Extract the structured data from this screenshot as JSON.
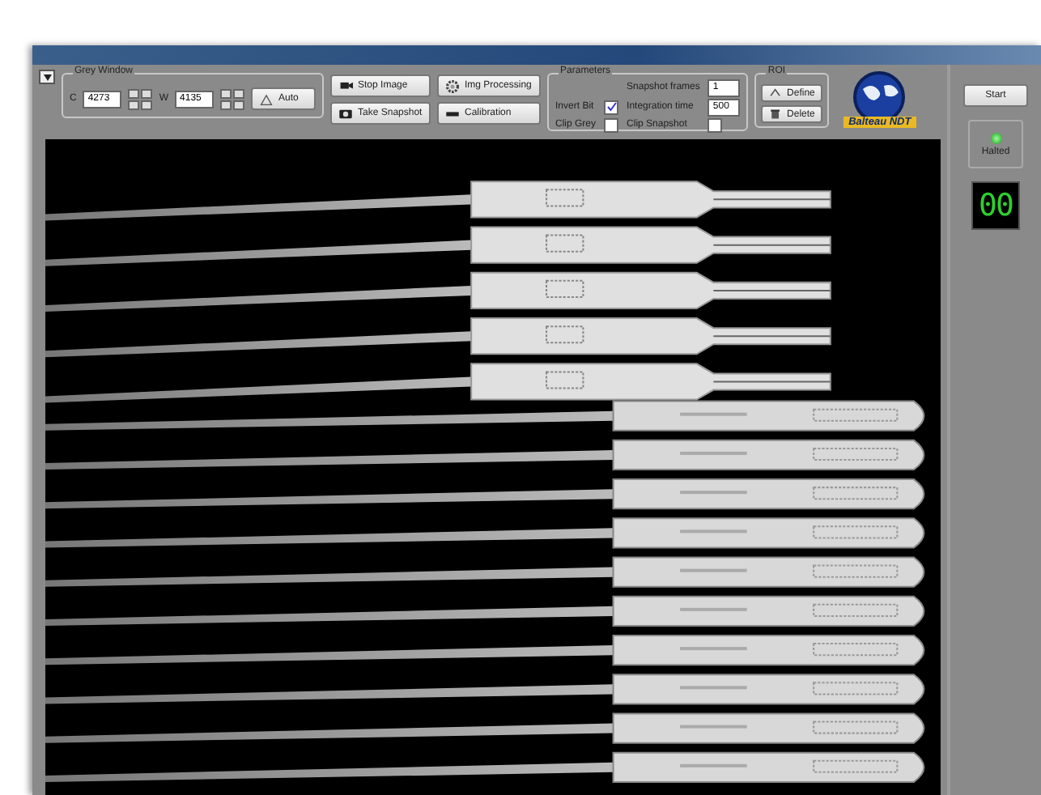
{
  "grey_window": {
    "title": "Grey Window",
    "c_label": "C",
    "c_value": "4273",
    "w_label": "W",
    "w_value": "4135",
    "auto_button": "Auto"
  },
  "actions": [
    {
      "label": "Stop Image",
      "kind": "camcorder"
    },
    {
      "label": "Take Snapshot",
      "kind": "camera"
    },
    {
      "label": "Img Processing",
      "kind": "gear"
    },
    {
      "label": "Calibration",
      "kind": "strip"
    }
  ],
  "parameters": {
    "title": "Parameters",
    "snapshot_frames_label": "Snapshot frames",
    "snapshot_frames": "1",
    "invert_bit": {
      "label": "Invert Bit",
      "checked": true
    },
    "integration_time_label": "Integration time",
    "integration_time": "500",
    "clip_grey": {
      "label": "Clip Grey",
      "checked": false
    },
    "clip_snapshot": {
      "label": "Clip Snapshot",
      "checked": false
    }
  },
  "roi": {
    "title": "ROI",
    "buttons": [
      {
        "label": "Define",
        "kind": "define"
      },
      {
        "label": "Delete",
        "kind": "delete"
      }
    ]
  },
  "logo": {
    "text": "Balteau NDT"
  },
  "side": {
    "start_button": "Start",
    "status": {
      "label": "Halted",
      "on": true
    },
    "counter": "00"
  }
}
